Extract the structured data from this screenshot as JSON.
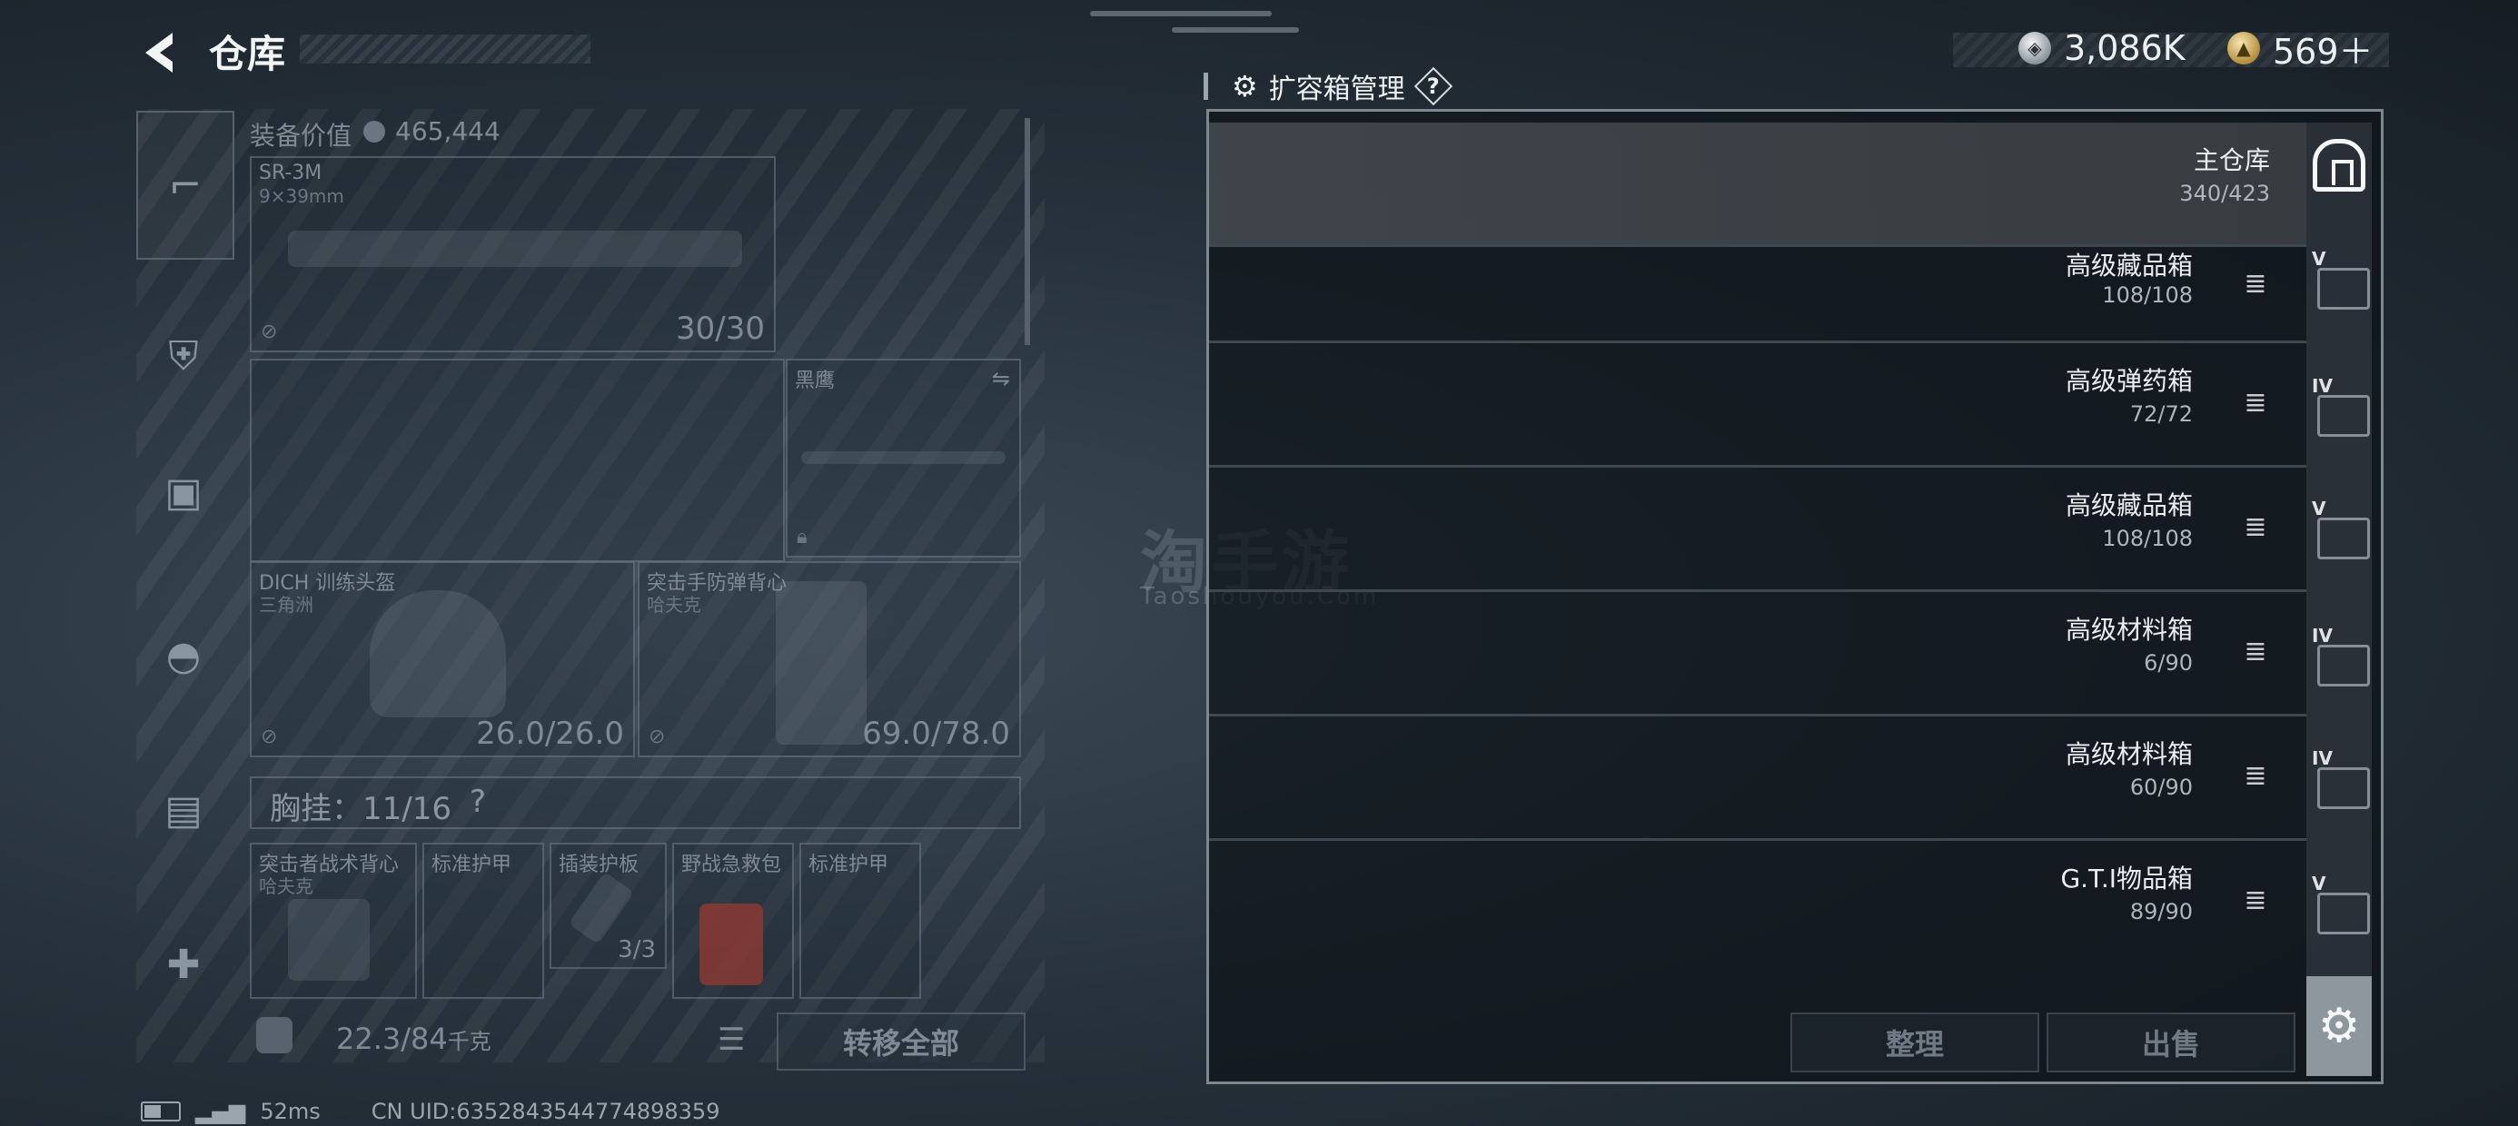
{
  "header": {
    "title": "仓库"
  },
  "currency": {
    "silver": "3,086K",
    "gold": "569＋"
  },
  "equipment": {
    "label": "装备价值",
    "value": "465,444",
    "weapon": {
      "name": "SR-3M",
      "caliber": "9×39mm",
      "ammo": "30/30"
    },
    "melee": {
      "name": "黑鹰"
    },
    "helmet": {
      "name": "DICH 训练头盔",
      "sub": "三角洲",
      "durability": "26.0/26.0"
    },
    "armor": {
      "name": "突击手防弹背心",
      "sub": "哈夫克",
      "durability": "69.0/78.0"
    },
    "chest_rig": "胸挂：11/16",
    "chest_help": "?",
    "rig_items": [
      {
        "name": "突击者战术背心",
        "sub": "哈夫克"
      },
      {
        "name": "标准护甲"
      },
      {
        "name": "插装护板",
        "count": "3/3"
      },
      {
        "name": "野战急救包"
      },
      {
        "name": "标准护甲"
      }
    ],
    "weight": "22.3/84",
    "weight_unit": "千克",
    "transfer_all": "转移全部"
  },
  "status": {
    "ping": "52ms",
    "uid": "CN UID:63528435447748983​59"
  },
  "expand": {
    "title": "扩容箱管理",
    "help": "?",
    "rows": [
      {
        "name": "主仓库",
        "cap": "340/423"
      },
      {
        "name": "高级藏品箱",
        "cap": "108/108",
        "tier": "V"
      },
      {
        "name": "高级弹药箱",
        "cap": "72/72",
        "tier": "IV"
      },
      {
        "name": "高级藏品箱",
        "cap": "108/108",
        "tier": "V"
      },
      {
        "name": "高级材料箱",
        "cap": "6/90",
        "tier": "IV"
      },
      {
        "name": "高级材料箱",
        "cap": "60/90",
        "tier": "IV"
      },
      {
        "name": "G.T.I物品箱",
        "cap": "89/90",
        "tier": "V"
      }
    ],
    "sort_label": "整理",
    "sell_label": "出售"
  },
  "watermark": {
    "main": "淘手游",
    "sub": "Taoshouyou.Com"
  }
}
